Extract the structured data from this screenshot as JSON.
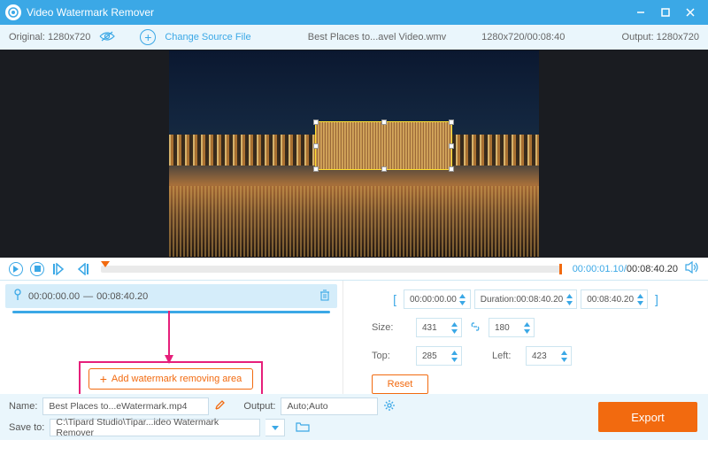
{
  "title": "Video Watermark Remover",
  "toolbar": {
    "original": "Original: 1280x720",
    "change_source": "Change Source File",
    "filename": "Best Places to...avel Video.wmv",
    "resolution_time": "1280x720/00:08:40",
    "output": "Output: 1280x720"
  },
  "timeline": {
    "current": "00:00:01.10",
    "total": "00:08:40.20"
  },
  "segment": {
    "start": "00:00:00.00",
    "end": "00:08:40.20"
  },
  "controls": {
    "range_start": "00:00:00.00",
    "duration_label": "Duration:",
    "duration_value": "00:08:40.20",
    "range_end": "00:08:40.20",
    "size_label": "Size:",
    "size_w": "431",
    "size_h": "180",
    "top_label": "Top:",
    "top_val": "285",
    "left_label": "Left:",
    "left_val": "423",
    "reset": "Reset"
  },
  "add_btn": "Add watermark removing area",
  "footer": {
    "name_label": "Name:",
    "name_value": "Best Places to...eWatermark.mp4",
    "output_label": "Output:",
    "output_value": "Auto;Auto",
    "saveto_label": "Save to:",
    "saveto_value": "C:\\Tipard Studio\\Tipar...ideo Watermark Remover",
    "export": "Export"
  }
}
